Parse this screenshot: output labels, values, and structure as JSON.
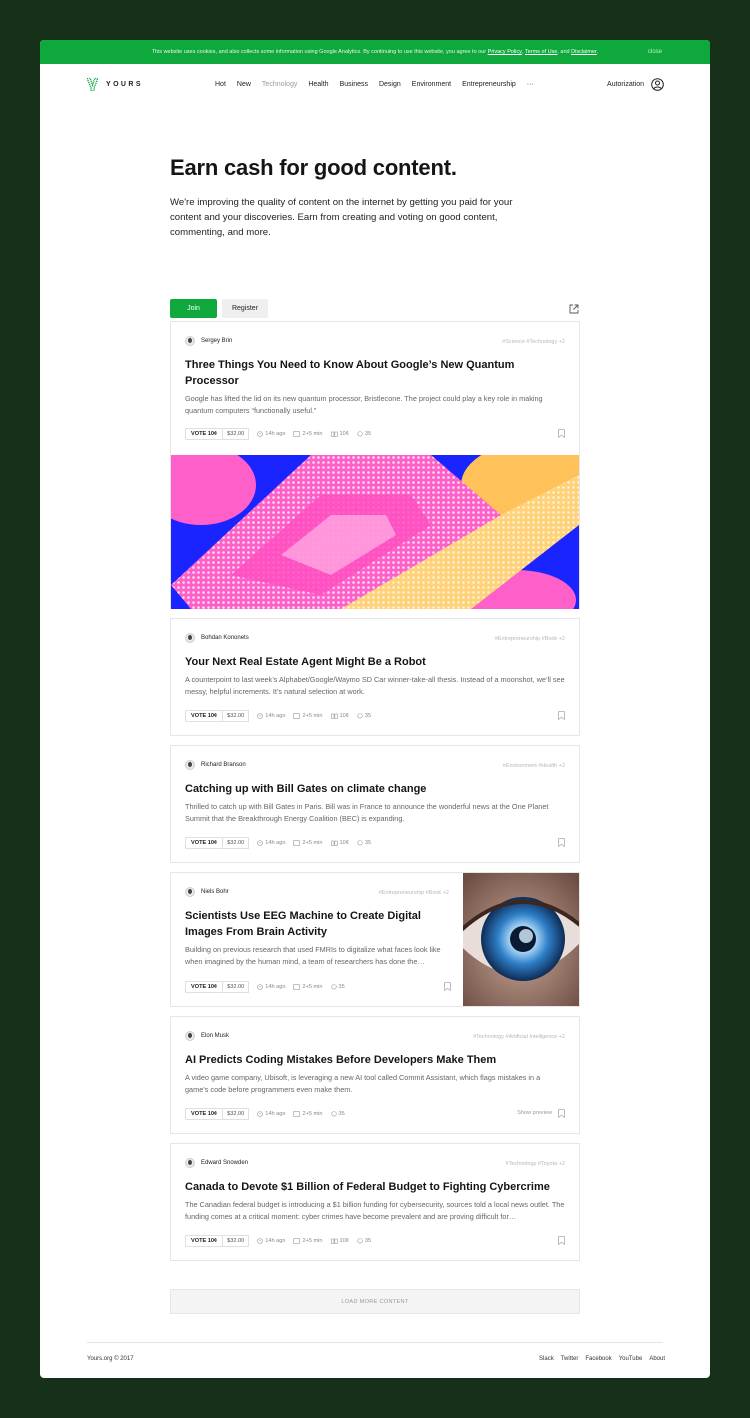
{
  "cookie": {
    "text": "This website uses cookies, and also collects some information using Google Analytics. By continuing to use this website, you agree to our",
    "privacy": "Privacy Policy",
    "terms": "Terms of Use",
    "and": ", and",
    "disclaimer": "Disclaimer",
    "close": "close"
  },
  "brand": {
    "name": "YOURS",
    "color": "#0fa83c"
  },
  "nav": {
    "items": [
      "Hot",
      "New",
      "Technology",
      "Health",
      "Business",
      "Design",
      "Environment",
      "Entrepreneurship",
      "···"
    ],
    "active": "Technology",
    "auth_label": "Autorization"
  },
  "hero": {
    "title": "Earn cash for good content.",
    "text": "We're improving the quality of content on the internet by getting you paid for your content and your discoveries. Earn from creating and voting on good content, commenting, and more.",
    "join": "Join",
    "register": "Register"
  },
  "posts": [
    {
      "author": "Sergey Brin",
      "tags": "#Science  #Technology  +2",
      "title": "Three Things You Need to Know About Google’s New Quantum Processor",
      "desc": "Google has lifted the lid on its new quantum processor, Bristlecone. The project could play a key role in making quantum computers “functionally useful.”",
      "vote": "VOTE 10¢",
      "price": "$32.00",
      "time": "14h ago",
      "read": "2+5 min",
      "earn": "10¢",
      "comments": "35"
    },
    {
      "author": "Bohdan Kononets",
      "tags": "#Entrepreneurship  #Book  +2",
      "title": "Your Next Real Estate Agent Might Be a Robot",
      "desc": "A counterpoint to last week’s Alphabet/Google/Waymo SD Car winner-take-all thesis. Instead of a moonshot, we’ll see messy, helpful increments. It’s natural selection at work.",
      "vote": "VOTE 10¢",
      "price": "$32.00",
      "time": "14h ago",
      "read": "2+5 min",
      "earn": "10¢",
      "comments": "35"
    },
    {
      "author": "Richard Branson",
      "tags": "#Environment  #Health  +2",
      "title": "Catching up with Bill Gates on climate change",
      "desc": "Thrilled to catch up with Bill Gates in Paris. Bill was in France to announce the wonderful news at the One Planet Summit that the Breakthrough Energy Coalition (BEC) is expanding.",
      "vote": "VOTE 10¢",
      "price": "$32.00",
      "time": "14h ago",
      "read": "2+5 min",
      "earn": "10¢",
      "comments": "35"
    },
    {
      "author": "Niels Bohr",
      "tags": "#Entrepreneurship  #Book  +2",
      "title": "Scientists Use EEG Machine to Create Digital Images From Brain Activity",
      "desc": "Building on previous research that used FMRIs to digitalize what faces look like when imagined by the human mind, a team of researchers has done the…",
      "vote": "VOTE 10¢",
      "price": "$32.00",
      "time": "14h ago",
      "read": "2+5 min",
      "comments": "35"
    },
    {
      "author": "Elon Musk",
      "tags": "#Technology  #Artificial Intelligence  +2",
      "title": "AI Predicts Coding Mistakes Before Developers Make Them",
      "desc": "A video game company, Ubisoft, is leveraging a new AI tool called Commit Assistant, which flags mistakes in a game’s code before programmers even make them.",
      "vote": "VOTE 10¢",
      "price": "$32.00",
      "time": "14h ago",
      "read": "2+5 min",
      "comments": "35",
      "preview": "Show preview"
    },
    {
      "author": "Edward Snowden",
      "tags": "#Technology  #Toyota  +2",
      "title": "Canada to Devote $1 Billion of Federal Budget to Fighting Cybercrime",
      "desc": "The Canadian federal budget is introducing a $1 billion funding for cybersecurity, sources told a local news outlet. The funding comes at a critical moment: cyber crimes have become prevalent and are proving difficult for…",
      "vote": "VOTE 10¢",
      "price": "$32.00",
      "time": "14h ago",
      "read": "2+5 min",
      "earn": "10¢",
      "comments": "35"
    }
  ],
  "load_more": "LOAD MORE CONTENT",
  "footer": {
    "copyright": "Yours.org © 2017",
    "links": [
      "Slack",
      "Twitter",
      "Facebook",
      "YouTube",
      "About"
    ]
  }
}
